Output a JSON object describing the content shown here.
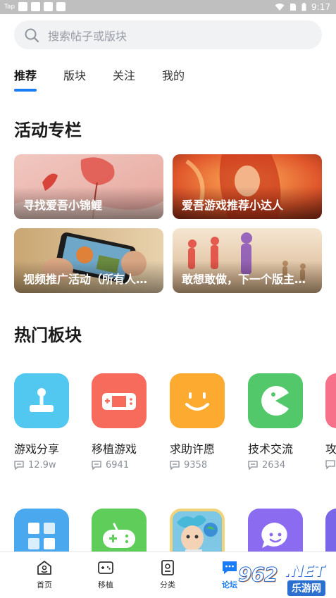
{
  "status_bar": {
    "app_tag": "Tap",
    "time": "9:17"
  },
  "search": {
    "placeholder": "搜索帖子或版块"
  },
  "tabs": [
    {
      "label": "推荐",
      "active": true
    },
    {
      "label": "版块",
      "active": false
    },
    {
      "label": "关注",
      "active": false
    },
    {
      "label": "我的",
      "active": false
    }
  ],
  "activity": {
    "title": "活动专栏",
    "cards": [
      {
        "title": "寻找爱吾小锦鲤"
      },
      {
        "title": "爱吾游戏推荐小达人"
      },
      {
        "title": "视频推广活动（所有人都可参加）"
      },
      {
        "title": "敢想敢做，下一个版主就是你"
      }
    ]
  },
  "hot": {
    "title": "热门板块",
    "boards": [
      {
        "name": "游戏分享",
        "count": "12.9w",
        "color": "#52c7f0",
        "icon": "joystick-icon"
      },
      {
        "name": "移植游戏",
        "count": "6941",
        "color": "#f76b5d",
        "icon": "handheld-console-icon"
      },
      {
        "name": "求助许愿",
        "count": "9358",
        "color": "#fdab30",
        "icon": "smile-face-icon"
      },
      {
        "name": "技术交流",
        "count": "2634",
        "color": "#52c86a",
        "icon": "pacman-icon"
      },
      {
        "name": "攻略",
        "count": "",
        "color": "#f7718a",
        "icon": "partial-board-icon"
      }
    ],
    "boards_row2": [
      {
        "color": "#4aa8ee",
        "icon": "grid-apps-icon"
      },
      {
        "color": "#5fcd5a",
        "icon": "gamepad-icon"
      },
      {
        "color": "#f2d37a",
        "icon": "cartoon-character-icon"
      },
      {
        "color": "#8b6cf0",
        "icon": "chat-heart-icon"
      },
      {
        "color": "#7a66e8",
        "icon": "partial-board-icon"
      }
    ]
  },
  "bottom_nav": [
    {
      "label": "首页",
      "icon": "home-icon",
      "active": false
    },
    {
      "label": "移植",
      "icon": "gamepad-icon",
      "active": false
    },
    {
      "label": "分类",
      "icon": "category-icon",
      "active": false
    },
    {
      "label": "论坛",
      "icon": "forum-icon",
      "active": true
    }
  ],
  "watermark": {
    "number": "962",
    "suffix": ".NET",
    "subtitle": "乐游网"
  },
  "colors": {
    "accent": "#1a7cf5",
    "search_bg": "#f1f2f4",
    "muted_text": "#8a8f98"
  }
}
